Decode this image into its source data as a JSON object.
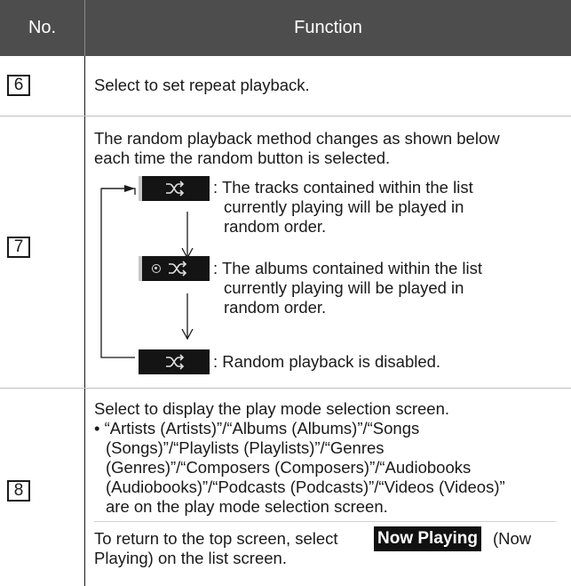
{
  "header": {
    "col_no": "No.",
    "col_function": "Function"
  },
  "rows": {
    "r6": {
      "number": "6",
      "text": "Select to set repeat playback."
    },
    "r7": {
      "number": "7",
      "intro": [
        "The random playback method changes as shown below",
        "each time the random button is selected."
      ],
      "mode_tracks": [
        ": The tracks contained within the list",
        "currently playing will be played in",
        "random order."
      ],
      "mode_albums": [
        ": The albums contained within the list",
        "currently playing will be played in",
        "random order."
      ],
      "mode_off": ": Random playback is disabled.",
      "icons": {
        "tracks_button": "shuffle-icon",
        "albums_button": "album-shuffle-icon",
        "off_button": "shuffle-icon"
      }
    },
    "r8": {
      "number": "8",
      "lines": [
        "Select to display the play mode selection screen.",
        "• “Artists (Artists)”/“Albums (Albums)”/“Songs",
        "(Songs)”/“Playlists (Playlists)”/“Genres",
        "(Genres)”/“Composers (Composers)”/“Audiobooks",
        "(Audiobooks)”/“Podcasts (Podcasts)”/“Videos (Videos)”",
        "are on the play mode selection screen."
      ],
      "return_before": "To return to the top screen, select ",
      "return_button": "Now Playing",
      "return_after": " (Now",
      "return_line2": "Playing) on the list screen."
    }
  },
  "colors": {
    "header_bg": "#4d4d4d",
    "button_bg": "#141414",
    "text": "#1a1a1a"
  }
}
